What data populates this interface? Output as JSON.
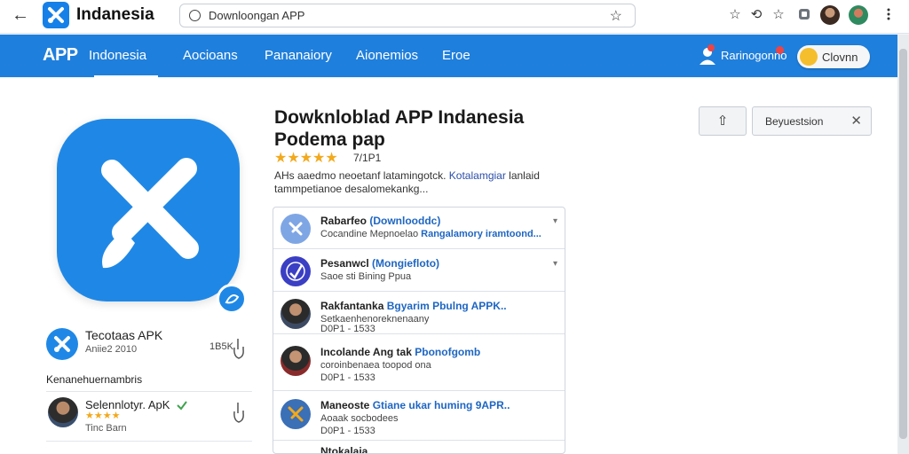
{
  "browser": {
    "brand": "Indanesia",
    "address": "Downloongan APP",
    "back_glyph": "←",
    "bookmark_glyph": "☆",
    "star_glyph": "☆",
    "refresh_glyph": "⟲"
  },
  "nav": {
    "logo": "APP",
    "items": [
      "Indonesia",
      "Aocioans",
      "Pananaiory",
      "Aionemios",
      "Eroe"
    ],
    "user_label": "Rarinogonno",
    "pill_label": "Clovnn"
  },
  "left": {
    "card_title": "Tecotaas APK",
    "card_sub": "Aniie2 2010",
    "card_count": "1B5K",
    "section_title": "Kenanehuernambris",
    "item_title": "Selennlotyr. ApK",
    "item_stars": "★★★★",
    "item_sub": "Tinc Barn"
  },
  "main": {
    "title_line1": "Dowknloblad APP Indanesia",
    "title_line2": "Podema pap",
    "stars": "★★★★★",
    "rating_text": "7/1P1",
    "desc_line1_a": "AHs aaedmo neoetanf latamingotck.",
    "desc_line1_link": "Kotalamgiar",
    "desc_line1_b": "lanlaid",
    "desc_line2": "tammpetianoe desalomekankg...",
    "items": [
      {
        "title": "Rabarfeo",
        "title_hl": "(Downlooddc)",
        "sub": "Cocandine Mepnoelao",
        "sub_hl": "Rangalamory iramtoond..."
      },
      {
        "title": "Pesanwcl",
        "title_hl": "(Mongiefloto)",
        "sub": "Saoe sti Bining Ppua",
        "sub_hl": ""
      },
      {
        "title": "Rakfantanka",
        "title_hl": "Bgyarim Pbulng APPK..",
        "sub": "Setkaenhenoreknenaany",
        "sub_hl": "",
        "sub2": "D0P1 - 1533"
      },
      {
        "title": "Incolande Ang tak",
        "title_hl": "Pbonofgomb",
        "sub": "coroinbenaea toopod ona",
        "sub_hl": "",
        "sub2": "D0P1 - 1533"
      },
      {
        "title": "Maneoste",
        "title_hl": "Gtiane ukar huming 9APR..",
        "sub": "Aoaak socbodees",
        "sub_hl": "",
        "sub2": "D0P1 - 1533"
      }
    ],
    "last_item_title": "Ntokalaia"
  },
  "right": {
    "share_glyph": "⇧",
    "filter_label": "Beyuestsion",
    "filter_close": "✕"
  },
  "colors": {
    "nav_blue": "#1f7fdc",
    "app_blue": "#1f88e6",
    "star_gold": "#f2a91c",
    "link_blue": "#1e66c2"
  }
}
